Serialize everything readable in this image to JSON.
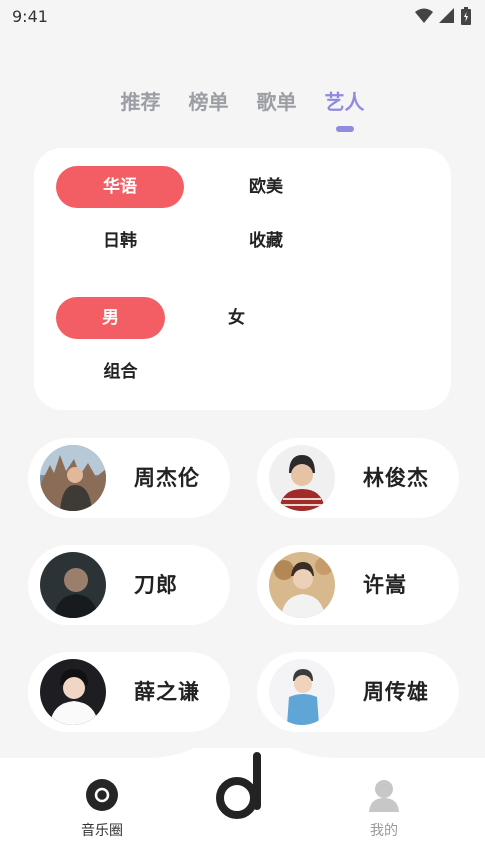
{
  "status": {
    "time": "9:41"
  },
  "tabs": [
    {
      "label": "推荐"
    },
    {
      "label": "榜单"
    },
    {
      "label": "歌单"
    },
    {
      "label": "艺人"
    }
  ],
  "active_tab": "艺人",
  "filters": {
    "region": [
      "华语",
      "欧美",
      "日韩",
      "收藏"
    ],
    "region_selected": "华语",
    "gender": [
      "男",
      "女",
      "组合"
    ],
    "gender_selected": "男"
  },
  "artists": [
    {
      "name": "周杰伦"
    },
    {
      "name": "林俊杰"
    },
    {
      "name": "刀郎"
    },
    {
      "name": "许嵩"
    },
    {
      "name": "薛之谦"
    },
    {
      "name": "周传雄"
    }
  ],
  "bottom_nav": {
    "left_label": "音乐圈",
    "right_label": "我的"
  },
  "colors": {
    "accent": "#8f8bdf",
    "chip_active": "#f25e63"
  }
}
